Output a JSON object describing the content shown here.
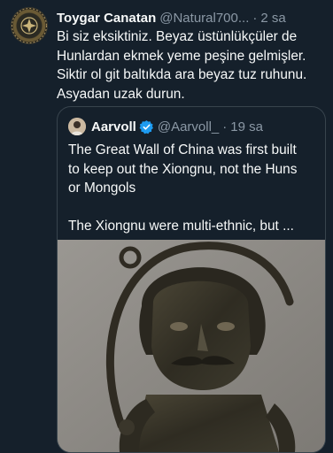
{
  "tweet": {
    "author_name": "Toygar Canatan",
    "author_handle": "@Natural700...",
    "separator": "·",
    "time": "2 sa",
    "more_icon": "more-dots-icon",
    "lines": [
      "Bi siz eksiktiniz. Beyaz üstünlükçüler de",
      "Hunlardan ekmek yeme peşine gelmişler.",
      "Siktir ol git baltıkda ara beyaz  tuz ruhunu.",
      "Asyadan uzak durun."
    ]
  },
  "quote": {
    "author_name": "Aarvoll",
    "author_handle": "@Aarvoll_",
    "separator": "·",
    "time": "19 sa",
    "verified_icon": "verified-badge-icon",
    "lines": [
      "The Great Wall of China was first built",
      "to keep out the Xiongnu, not the Huns",
      "or Mongols",
      "",
      "The Xiongnu were multi-ethnic, but ..."
    ]
  },
  "colors": {
    "background": "#15202b",
    "text": "#f7f9f9",
    "secondary": "#8b98a5",
    "border": "#38444d",
    "verified": "#1d9bf0"
  }
}
